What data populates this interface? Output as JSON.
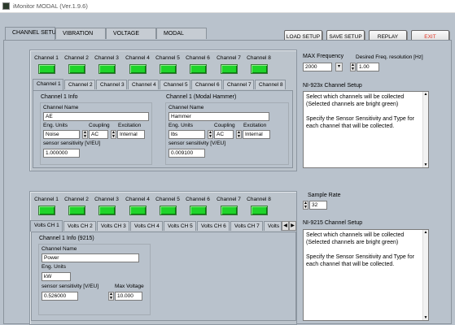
{
  "window": {
    "title": "iMonitor MODAL (Ver.1.9.6)"
  },
  "main_tabs": [
    "CHANNEL SETUP",
    "VIBRATION",
    "VOLTAGE",
    "MODAL"
  ],
  "buttons": {
    "load": "LOAD SETUP",
    "save": "SAVE SETUP",
    "replay": "REPLAY",
    "exit": "EXIT"
  },
  "colors": {
    "led_on": "#1fd42a",
    "exit_text": "#e03020",
    "background": "#b9c2cc"
  },
  "channels": [
    "Channel 1",
    "Channel 2",
    "Channel 3",
    "Channel 4",
    "Channel 5",
    "Channel 6",
    "Channel 7",
    "Channel 8"
  ],
  "ni923x": {
    "max_freq_label": "MAX Frequency",
    "max_freq_value": "2000",
    "resolution_label": "Desired Freq. resolution [Hz]",
    "resolution_value": "1.00",
    "subtabs": [
      "Channel 1",
      "Channel 2",
      "Channel 3",
      "Channel 4",
      "Channel 5",
      "Channel 6",
      "Channel 7",
      "Channel 8"
    ],
    "ch1": {
      "info_title": "Channel 1 Info",
      "name_label": "Channel Name",
      "name": "AE",
      "units_label": "Eng. Units",
      "units": "Noise",
      "coupling_label": "Coupling",
      "coupling": "AC",
      "excitation_label": "Excitation",
      "excitation": "Internal",
      "sens_label": "sensor sensitivity [V/EU]",
      "sens": "1.000000"
    },
    "ch1_modal": {
      "info_title": "Channel 1 (Modal Hammer)",
      "name_label": "Channel Name",
      "name": "Hammer",
      "units_label": "Eng. Units",
      "units": "lbs",
      "coupling_label": "Coupling",
      "coupling": "AC",
      "excitation_label": "Excitation",
      "excitation": "Internal",
      "sens_label": "sensor sensitivity [V/EU]",
      "sens": "0.009100"
    },
    "setup_title": "NI-923x Channel Setup",
    "setup_text": "Select which channels will be collected (Selected channels are bright green)\n\nSpecify the Sensor Sensitivity and Type for each channel that will be collected."
  },
  "ni9215": {
    "sample_rate_label": "Sample Rate",
    "sample_rate": "32",
    "subtabs": [
      "Volts CH 1",
      "Volts CH 2",
      "Volts CH 3",
      "Volts CH 4",
      "Volts CH 5",
      "Volts CH 6",
      "Volts CH 7",
      "Volts CH"
    ],
    "ch1": {
      "info_title": "Channel 1 Info (9215)",
      "name_label": "Channel Name",
      "name": "Power",
      "units_label": "Eng. Units",
      "units": "kW",
      "sens_label": "sensor sensitivity [V/EU]",
      "sens": "0.526000",
      "maxv_label": "Max Voltage",
      "maxv": "10.000"
    },
    "setup_title": "NI-9215 Channel Setup",
    "setup_text": "Select which channels will be collected (Selected channels are bright green)\n\nSpecify the Sensor Sensitivity and Type for each channel that will be collected."
  }
}
